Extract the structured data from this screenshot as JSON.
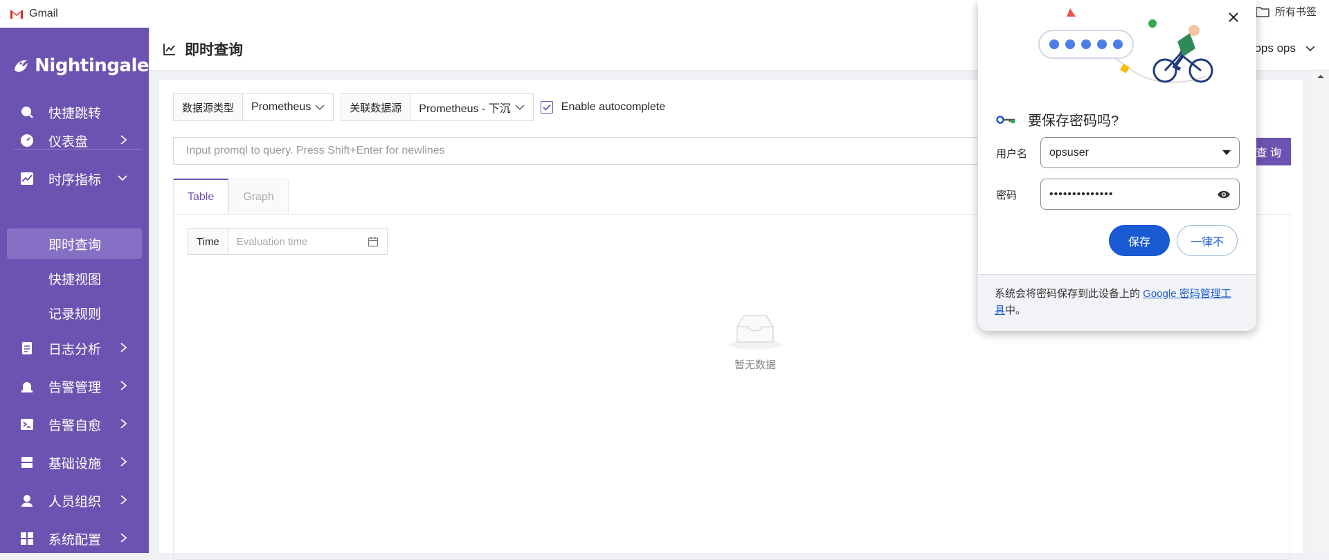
{
  "bookmarks": {
    "gmail": "Gmail",
    "folder": "所有书签"
  },
  "sidebar": {
    "brand": "Nightingale",
    "items": [
      {
        "label": "快捷跳转"
      },
      {
        "label": "仪表盘"
      },
      {
        "label": "时序指标"
      },
      {
        "label": "日志分析"
      },
      {
        "label": "告警管理"
      },
      {
        "label": "告警自愈"
      },
      {
        "label": "基础设施"
      },
      {
        "label": "人员组织"
      },
      {
        "label": "系统配置"
      }
    ],
    "subitems": [
      {
        "label": "即时查询"
      },
      {
        "label": "快捷视图"
      },
      {
        "label": "记录规则"
      }
    ]
  },
  "header": {
    "title": "即时查询",
    "user": "ops ops"
  },
  "query": {
    "datasource_type_label": "数据源类型",
    "datasource_type_value": "Prometheus",
    "datasource_label": "关联数据源",
    "datasource_value": "Prometheus - 下沉",
    "autocomplete_label": "Enable autocomplete",
    "input_placeholder": "Input promql to query. Press Shift+Enter for newlines",
    "query_button": "查 询"
  },
  "tabs": [
    {
      "label": "Table"
    },
    {
      "label": "Graph"
    }
  ],
  "table": {
    "time_label": "Time",
    "time_placeholder": "Evaluation time",
    "empty": "暂无数据"
  },
  "popup": {
    "title": "要保存密码吗?",
    "username_label": "用户名",
    "username_value": "opsuser",
    "password_label": "密码",
    "password_value": "••••••••••••••",
    "save": "保存",
    "never": "一律不",
    "footer_text": "系统会将密码保存到此设备上的 ",
    "footer_link": "Google 密码管理工具",
    "footer_end": "中。"
  }
}
